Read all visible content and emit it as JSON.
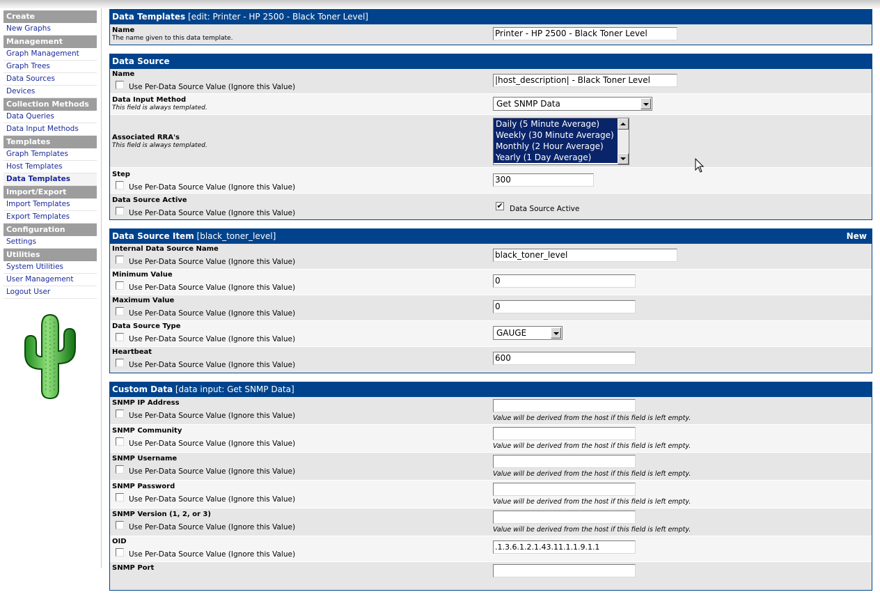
{
  "sidebar": {
    "sections": [
      {
        "head": "Create",
        "items": [
          {
            "label": "New Graphs"
          }
        ]
      },
      {
        "head": "Management",
        "items": [
          {
            "label": "Graph Management"
          },
          {
            "label": "Graph Trees"
          },
          {
            "label": "Data Sources"
          },
          {
            "label": "Devices"
          }
        ]
      },
      {
        "head": "Collection Methods",
        "items": [
          {
            "label": "Data Queries"
          },
          {
            "label": "Data Input Methods"
          }
        ]
      },
      {
        "head": "Templates",
        "items": [
          {
            "label": "Graph Templates"
          },
          {
            "label": "Host Templates"
          },
          {
            "label": "Data Templates",
            "active": true
          }
        ]
      },
      {
        "head": "Import/Export",
        "items": [
          {
            "label": "Import Templates"
          },
          {
            "label": "Export Templates"
          }
        ]
      },
      {
        "head": "Configuration",
        "items": [
          {
            "label": "Settings"
          }
        ]
      },
      {
        "head": "Utilities",
        "items": [
          {
            "label": "System Utilities"
          },
          {
            "label": "User Management"
          },
          {
            "label": "Logout User"
          }
        ]
      }
    ]
  },
  "template_panel": {
    "title": "Data Templates",
    "subtitle": "[edit: Printer - HP 2500 - Black Toner Level]",
    "name_label": "Name",
    "name_desc": "The name given to this data template.",
    "name_value": "Printer - HP 2500 - Black Toner Level"
  },
  "common": {
    "per_ds": "Use Per-Data Source Value (Ignore this Value)",
    "templated": "This field is always templated.",
    "derived_hint": "Value will be derived from the host if this field is left empty."
  },
  "data_source": {
    "title": "Data Source",
    "name_label": "Name",
    "name_value": "|host_description| - Black Toner Level",
    "input_method_label": "Data Input Method",
    "input_method_value": "Get SNMP Data",
    "rra_label": "Associated RRA's",
    "rra_options": [
      "Daily (5 Minute Average)",
      "Weekly (30 Minute Average)",
      "Monthly (2 Hour Average)",
      "Yearly (1 Day Average)"
    ],
    "step_label": "Step",
    "step_value": "300",
    "active_label": "Data Source Active",
    "active_checkbox_label": "Data Source Active",
    "active_checked": "✔"
  },
  "ds_item": {
    "title": "Data Source Item",
    "subtitle": "[black_toner_level]",
    "new_label": "New",
    "internal_name_label": "Internal Data Source Name",
    "internal_name_value": "black_toner_level",
    "min_label": "Minimum Value",
    "min_value": "0",
    "max_label": "Maximum Value",
    "max_value": "0",
    "type_label": "Data Source Type",
    "type_value": "GAUGE",
    "heartbeat_label": "Heartbeat",
    "heartbeat_value": "600"
  },
  "custom_data": {
    "title": "Custom Data",
    "subtitle": "[data input: Get SNMP Data]",
    "fields": [
      {
        "label": "SNMP IP Address",
        "value": "",
        "hint": true
      },
      {
        "label": "SNMP Community",
        "value": "",
        "hint": true
      },
      {
        "label": "SNMP Username",
        "value": "",
        "hint": true
      },
      {
        "label": "SNMP Password",
        "value": "",
        "hint": true
      },
      {
        "label": "SNMP Version (1, 2, or 3)",
        "value": "",
        "hint": true
      },
      {
        "label": "OID",
        "value": ".1.3.6.1.2.1.43.11.1.1.9.1.1",
        "hint": false
      },
      {
        "label": "SNMP Port",
        "value": "",
        "hint": false
      }
    ]
  },
  "icons": [
    "cactus-logo-icon",
    "checkbox-icon",
    "dropdown-arrow-icon",
    "mouse-pointer-icon"
  ],
  "colors": {
    "panel_header": "#00438c",
    "menu_header": "#9d9d9d",
    "link": "#1a2a9a",
    "row_odd": "#e6e6e6",
    "row_even": "#f5f5f5",
    "selection": "#0a246a"
  }
}
